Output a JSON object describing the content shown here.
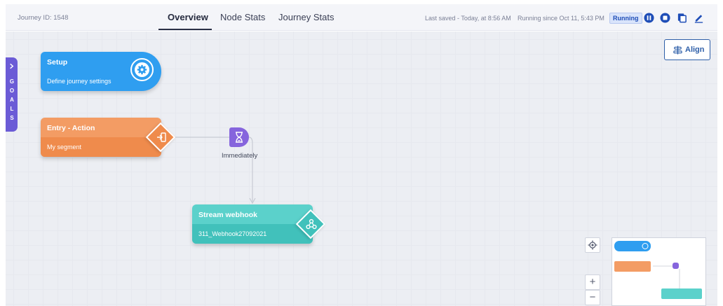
{
  "header": {
    "journey_id": "Journey ID: 1548",
    "tabs": [
      {
        "label": "Overview",
        "active": true
      },
      {
        "label": "Node Stats",
        "active": false
      },
      {
        "label": "Journey Stats",
        "active": false
      }
    ],
    "last_saved": "Last saved - Today, at 8:56 AM",
    "running_since": "Running since Oct 11, 5:43 PM",
    "status_badge": "Running"
  },
  "goals_tab": {
    "label": "GOALS",
    "icon": "chevron-right-icon"
  },
  "align_button": {
    "label": "Align",
    "icon": "align-icon"
  },
  "nodes": {
    "setup": {
      "title": "Setup",
      "subtitle": "Define journey settings",
      "icon": "gear-icon",
      "color": "#2f9ef0"
    },
    "entry": {
      "title": "Entry - Action",
      "subtitle": "My segment",
      "icon": "entry-icon",
      "color": "#f39c64"
    },
    "wait": {
      "label": "Immediately",
      "icon": "hourglass-icon",
      "color": "#8665dd"
    },
    "stream": {
      "title": "Stream webhook",
      "subtitle": "311_Webhook27092021",
      "icon": "webhook-icon",
      "color": "#5bd1cb"
    }
  },
  "map_controls": {
    "zoom_in": "+",
    "zoom_out": "−",
    "center_icon": "locate-icon"
  },
  "colors": {
    "accent": "#2d5ea8",
    "running_badge": "#d9e4fb",
    "toolbar_icons": "#1e4db7"
  }
}
